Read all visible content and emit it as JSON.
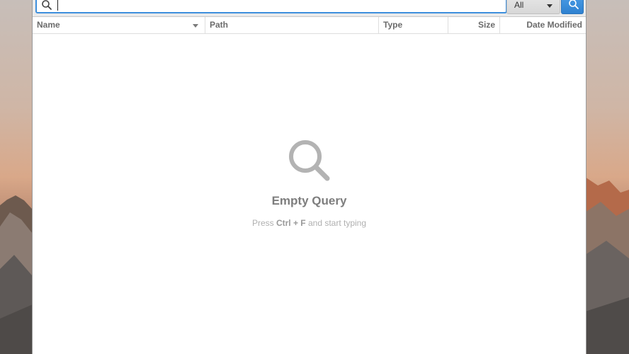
{
  "toolbar": {
    "search_icon": "search-icon",
    "search_value": "",
    "filter_value": "All",
    "submit_icon": "search-icon"
  },
  "columns": [
    {
      "label": "Name",
      "sorted": "descending"
    },
    {
      "label": "Path"
    },
    {
      "label": "Type"
    },
    {
      "label": "Size"
    },
    {
      "label": "Date Modified"
    }
  ],
  "empty_state": {
    "icon": "magnifier-icon",
    "title": "Empty Query",
    "hint_prefix": "Press ",
    "hint_shortcut": "Ctrl + F",
    "hint_suffix": " and start typing"
  },
  "colors": {
    "accent": "#3d8fdc",
    "button": "#2f81d0",
    "muted_text": "#7d7d7d"
  }
}
